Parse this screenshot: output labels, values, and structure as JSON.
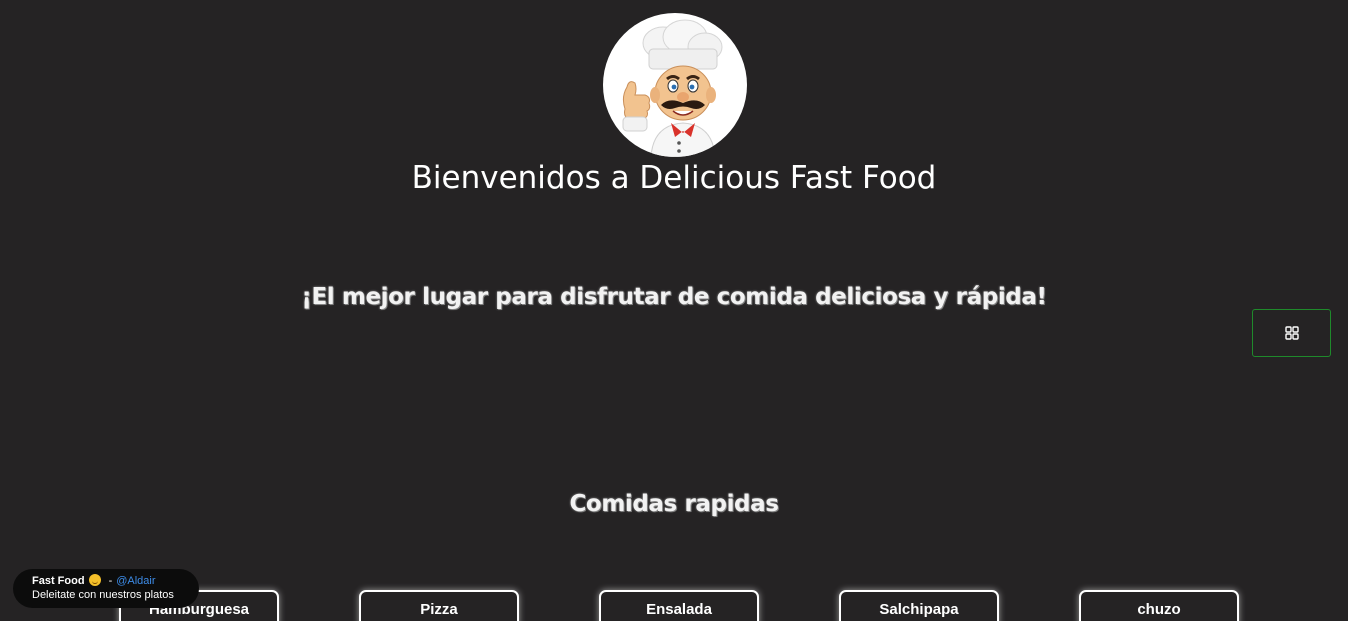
{
  "header": {
    "logo_icon": "chef-mascot-icon",
    "title": "Bienvenidos a Delicious Fast Food",
    "tagline": "¡El mejor lugar para disfrutar de comida deliciosa y rápida!"
  },
  "menu_toggle": {
    "icon": "grid-icon",
    "border_color": "#1f8a2b"
  },
  "section": {
    "title": "Comidas rapidas"
  },
  "foods": [
    {
      "label": "Hamburguesa"
    },
    {
      "label": "Pizza"
    },
    {
      "label": "Ensalada"
    },
    {
      "label": "Salchipapa"
    },
    {
      "label": "chuzo"
    }
  ],
  "toast": {
    "title": "Fast Food",
    "emoji_icon": "smiling-face-icon",
    "separator": "-",
    "handle": "@Aldair",
    "message": "Deleitate con nuestros platos",
    "handle_color": "#3d8ce8"
  },
  "colors": {
    "background": "#252324",
    "text": "#ffffff"
  }
}
